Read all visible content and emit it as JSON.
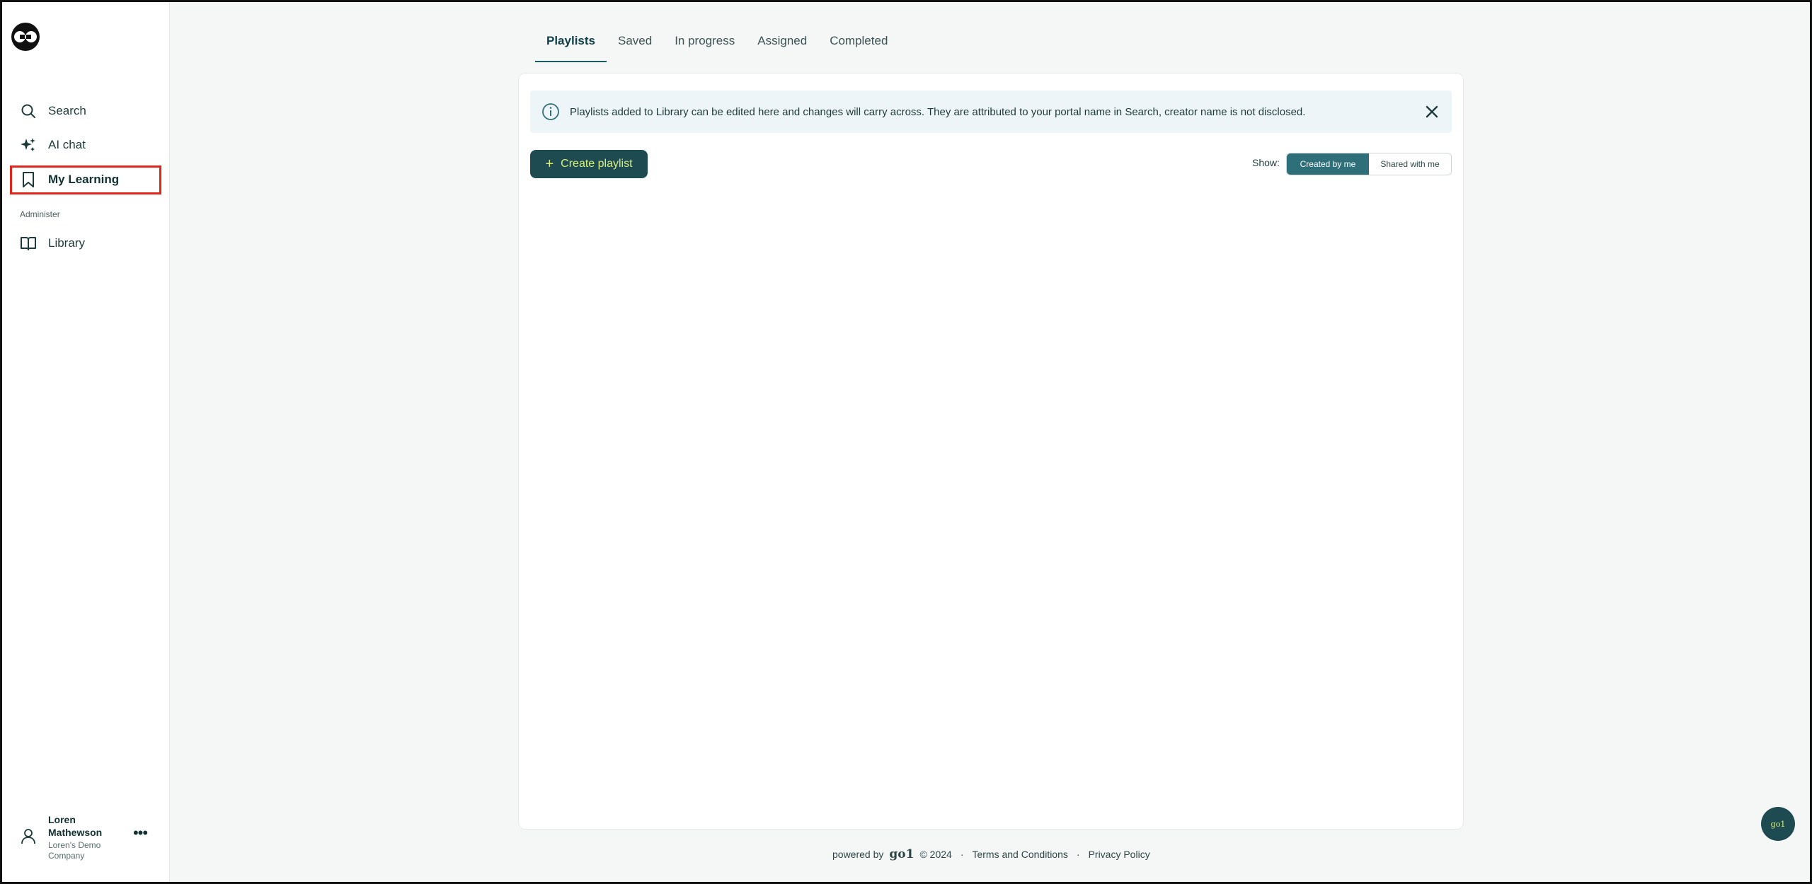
{
  "app": {
    "logo": "go1-logo-icon"
  },
  "sidebar": {
    "items": [
      {
        "label": "Search",
        "icon": "search-icon"
      },
      {
        "label": "AI chat",
        "icon": "sparkle-icon"
      },
      {
        "label": "My Learning",
        "icon": "bookmark-icon",
        "active": true
      }
    ],
    "section_label": "Administer",
    "admin_items": [
      {
        "label": "Library",
        "icon": "book-icon"
      }
    ],
    "user": {
      "name": "Loren Mathewson",
      "company": "Loren's Demo Company"
    }
  },
  "tabs": [
    {
      "label": "Playlists",
      "active": true
    },
    {
      "label": "Saved"
    },
    {
      "label": "In progress"
    },
    {
      "label": "Assigned"
    },
    {
      "label": "Completed"
    }
  ],
  "banner": {
    "text": "Playlists added to Library can be edited here and changes will carry across. They are attributed to your portal name in Search, creator name is not disclosed."
  },
  "toolbar": {
    "create_label": "Create playlist",
    "show_label": "Show:",
    "filter_options": [
      "Created by me",
      "Shared with me"
    ],
    "selected_filter": "Created by me"
  },
  "footer": {
    "powered_by": "powered by",
    "brand": "go1",
    "copyright": "© 2024",
    "terms": "Terms and Conditions",
    "privacy": "Privacy Policy"
  },
  "fab": {
    "label": "go1"
  },
  "colors": {
    "accent": "#1e4a52",
    "accent_text": "#d7f07a",
    "highlight": "#e0261c",
    "active_segment": "#2f6f7a"
  }
}
